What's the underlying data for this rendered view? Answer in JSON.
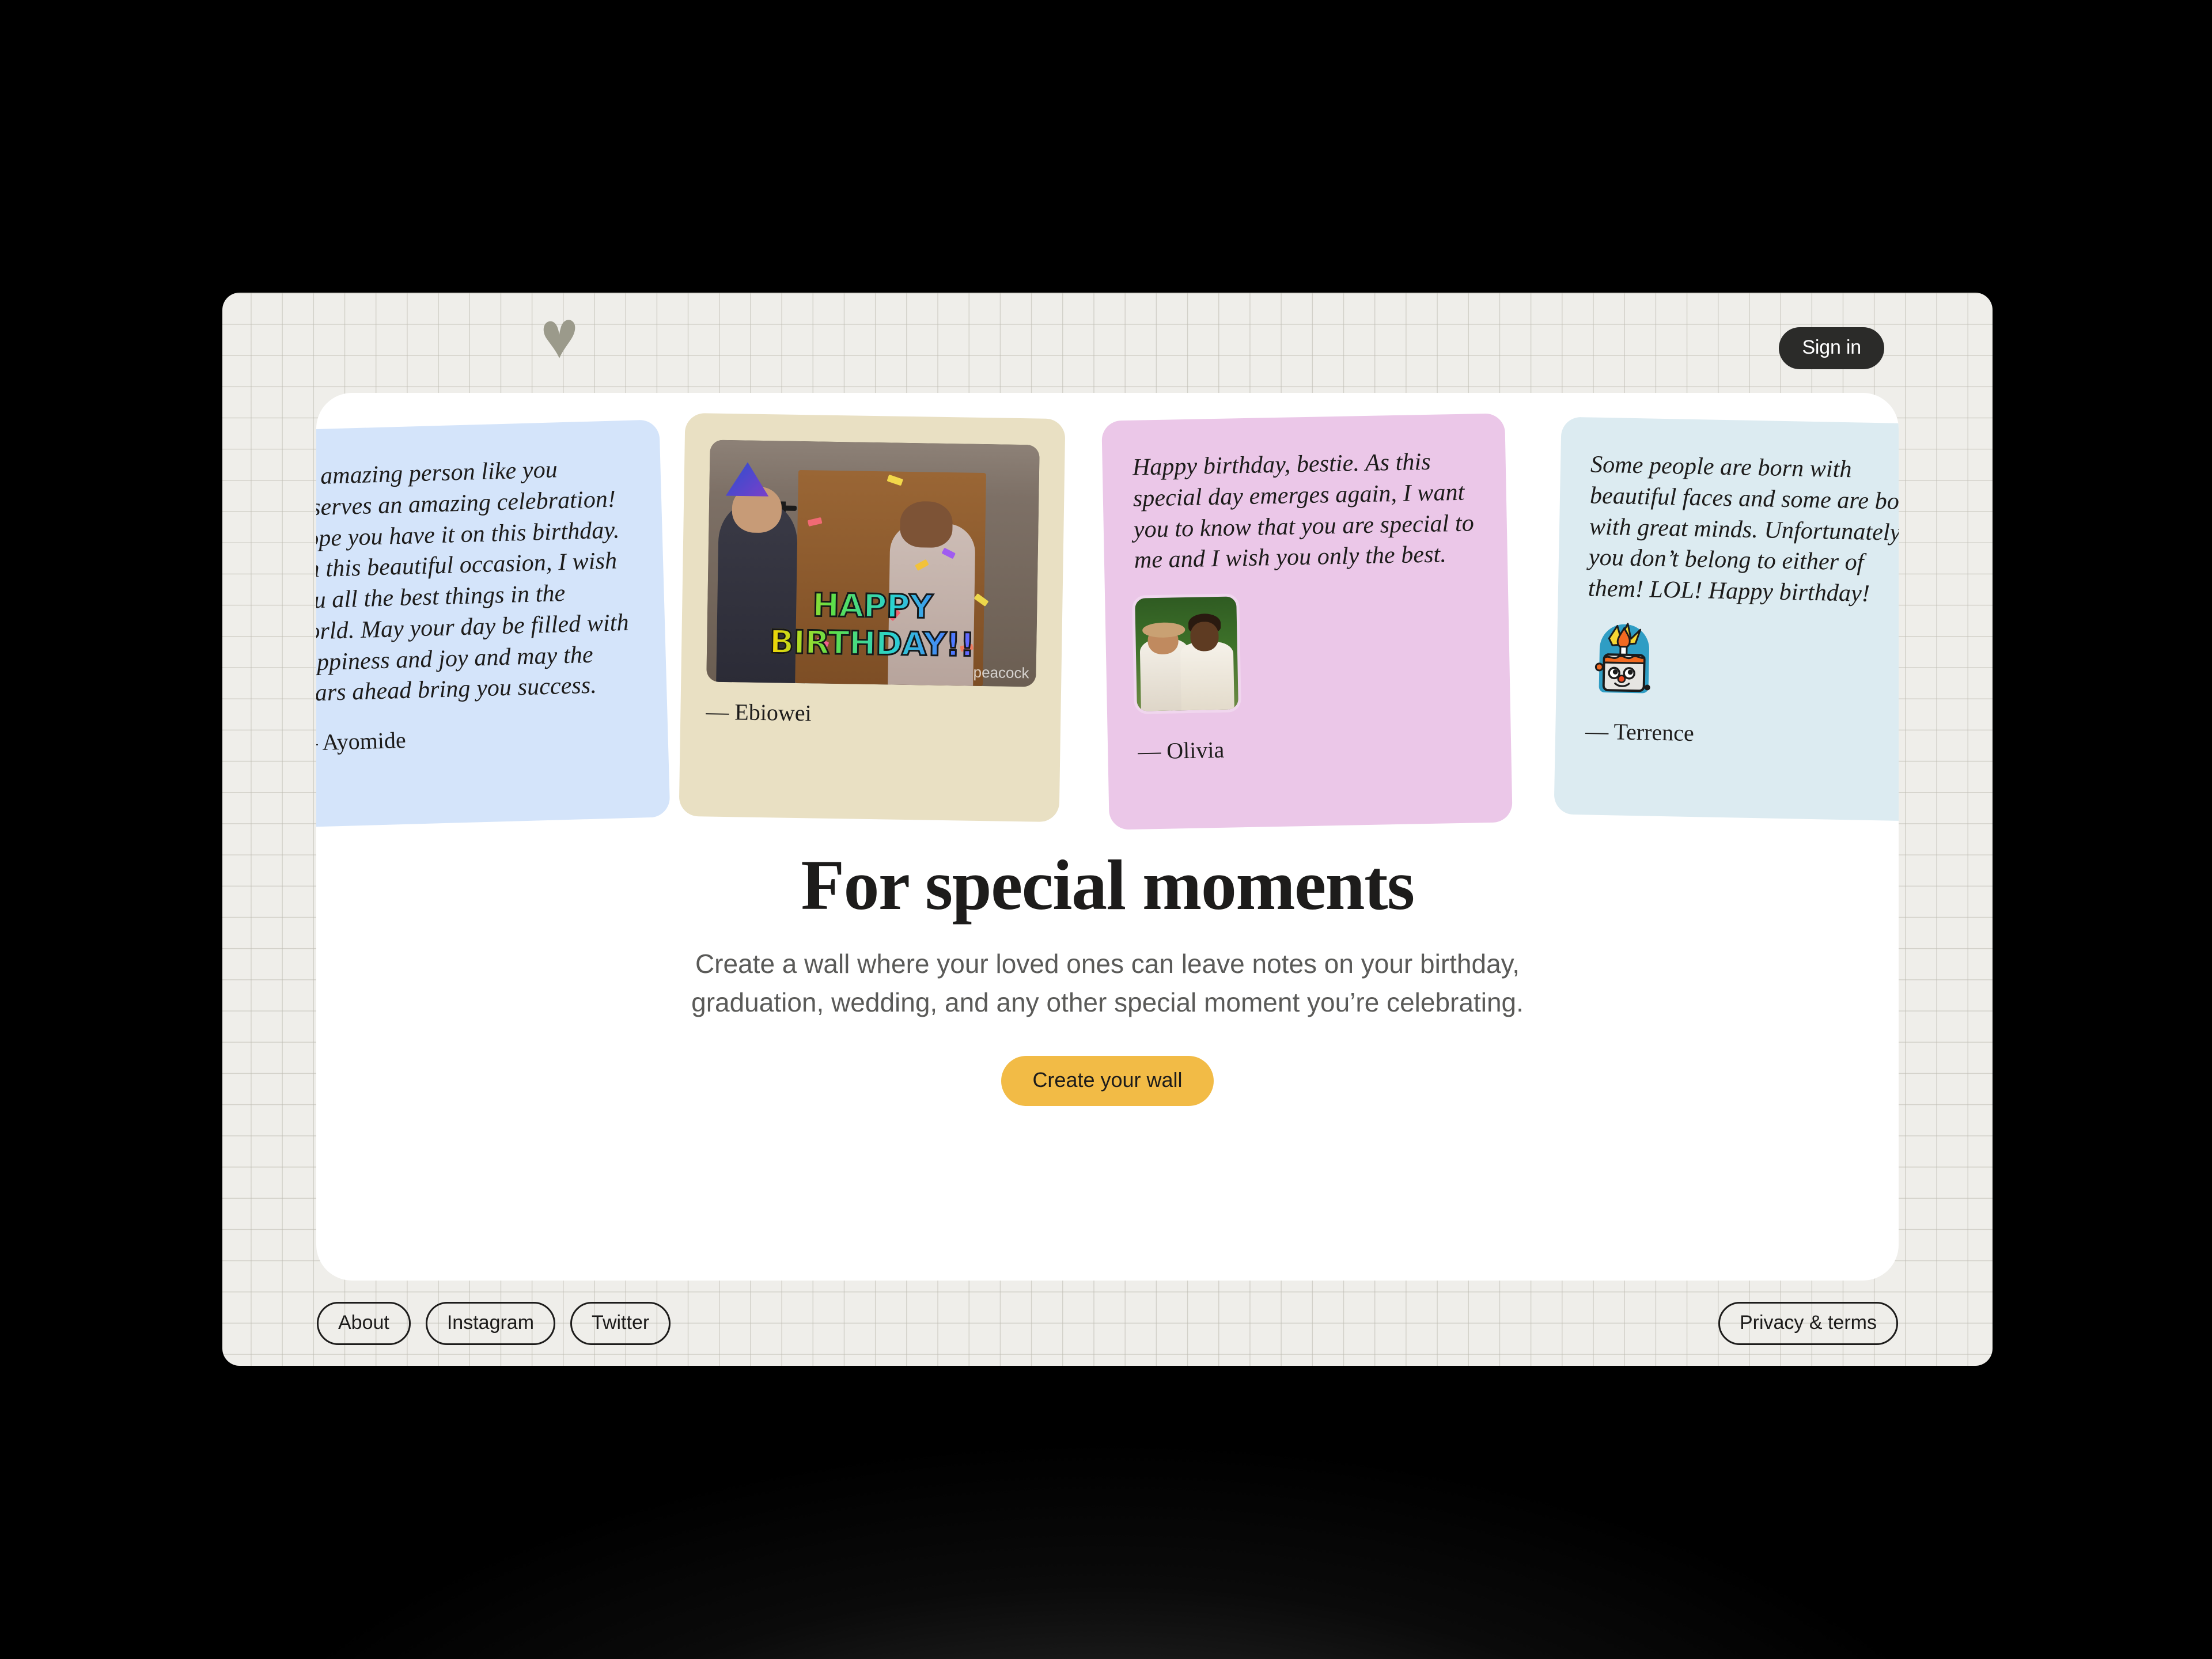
{
  "site": {
    "logo_icon": "heart-icon",
    "logo_color": "#9b9a8b"
  },
  "header": {
    "signin_label": "Sign in"
  },
  "cards": [
    {
      "id": "card-ayomide",
      "color": "#d4e4fa",
      "message": "An amazing person like you deserves an amazing celebration! Hope you have it on this birthday. On this beautiful occasion, I wish you all the best things in the world. May your day be filled with happiness and joy and may the years ahead bring you success.",
      "author": "— Ayomide",
      "media": "none"
    },
    {
      "id": "card-ebiowei",
      "color": "#e9e0c3",
      "message": "",
      "author": "— Ebiowei",
      "media": "gif",
      "gif_caption": "HAPPY BIRTHDAY!!",
      "gif_watermark": "peacock"
    },
    {
      "id": "card-olivia",
      "color": "#ebc7e8",
      "message": "Happy birthday, bestie. As this special day emerges again, I want you to know that you are special to me and I wish you only the best.",
      "author": "— Olivia",
      "media": "photo"
    },
    {
      "id": "card-terrence",
      "color": "#dcebf1",
      "message": "Some people are born with beautiful faces and some are born with great minds. Unfortunately, you don’t belong to either of them! LOL! Happy birthday!",
      "author": "— Terrence",
      "media": "sticker",
      "sticker_icon": "birthday-cake-sticker"
    }
  ],
  "hero": {
    "title": "For special moments",
    "subtitle": "Create a wall where your loved ones can leave notes on your birthday, graduation, wedding, and any other special moment you’re celebrating.",
    "cta_label": "Create your wall",
    "cta_color": "#f2bb46"
  },
  "footer": {
    "links": [
      {
        "label": "About"
      },
      {
        "label": "Instagram"
      },
      {
        "label": "Twitter"
      }
    ],
    "privacy_label": "Privacy & terms"
  }
}
